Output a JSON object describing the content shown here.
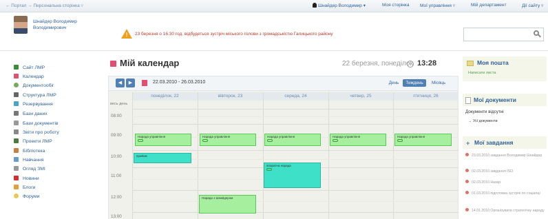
{
  "topbar": {
    "breadcrumb": "← Портал  →  Персональна сторінка ▿",
    "user_link": "Шнайдер Володимир ▾",
    "my_page": "Моя сторінка",
    "my_management": "Мої управління ▿",
    "my_department": "Мій департамент",
    "site_actions": "Дії сайту ▿"
  },
  "header": {
    "owner_name": "Шнайдер Володимир Володимирович",
    "announcement": "23 березня о 16.30 год. відбудеться зустріч міського голови з громадськістю Галицького району",
    "search_placeholder": ""
  },
  "sidebar": {
    "items": [
      {
        "label": "Сайт ЛМР",
        "color": "#3c8a3c"
      },
      {
        "label": "Календар",
        "color": "#e05070"
      },
      {
        "label": "Документообіг",
        "color": "#7aa860"
      },
      {
        "label": "Структура ЛМР",
        "color": "#666666"
      },
      {
        "label": "Резервування",
        "color": "#4aa3c8"
      },
      {
        "label": "Бази даних",
        "color": "#777777"
      },
      {
        "label": "Бази документів",
        "color": "#999999"
      },
      {
        "label": "Звіти про роботу",
        "color": "#888888"
      },
      {
        "label": "Проекти ЛМР",
        "color": "#4a7a40"
      },
      {
        "label": "Бібліотека",
        "color": "#c88040"
      },
      {
        "label": "Навчання",
        "color": "#6a9ac8"
      },
      {
        "label": "Огляд ЗМІ",
        "color": "#999999"
      },
      {
        "label": "Новини",
        "color": "#d03030"
      },
      {
        "label": "Блоги",
        "color": "#e0a040"
      },
      {
        "label": "Форуми",
        "color": "#e8c850"
      }
    ]
  },
  "calendar": {
    "title": "Мій календар",
    "current_date": "22 березня, понеділок",
    "current_time": "13:28",
    "prev_label": "◀",
    "next_label": "▶",
    "range": "22.03.2010 - 26.03.2010",
    "views": {
      "day": "День",
      "week": "Тиждень",
      "month": "Місяць"
    },
    "all_day_label": "весь день",
    "days": [
      "понеділок, 22",
      "вівторок, 23",
      "середа, 24",
      "четвер, 25",
      "п'ятниця, 26"
    ],
    "hours": [
      "08:00",
      "09:00",
      "10:00",
      "11:00",
      "12:00",
      "13:00"
    ],
    "events": [
      {
        "day": 0,
        "title": "Нарада управління",
        "style": "green"
      },
      {
        "day": 1,
        "title": "Нарада управління",
        "style": "green"
      },
      {
        "day": 2,
        "title": "Нарада управління",
        "style": "green"
      },
      {
        "day": 3,
        "title": "Нарада управління",
        "style": "green"
      },
      {
        "day": 4,
        "title": "Нарада управління",
        "style": "green"
      },
      {
        "day": 0,
        "title": "прийом",
        "style": "teal"
      },
      {
        "day": 2,
        "title": "апаратна нарада",
        "style": "teal"
      },
      {
        "day": 1,
        "title": "Нарада з Шнайдером",
        "style": "green"
      }
    ]
  },
  "right": {
    "mail_title": "Моя пошта",
    "mail_link": "Написати листа",
    "docs_title": "Мої документи",
    "docs_empty": "Документи відсутні",
    "docs_all": "Усі документи",
    "tasks_title": "Мої завдання",
    "tasks": [
      {
        "date": "23.03.2010",
        "text": "завдання Володимир Шнайдер"
      },
      {
        "date": "02.03.2010",
        "text": "завдання ISO"
      },
      {
        "date": "02.03.2010",
        "text": "Назар"
      },
      {
        "date": "01.03.2010",
        "text": "підготовка зустрічі по соціалці"
      },
      {
        "date": "14.01.2010",
        "text": "Організувати стратегічну нараду"
      }
    ]
  }
}
